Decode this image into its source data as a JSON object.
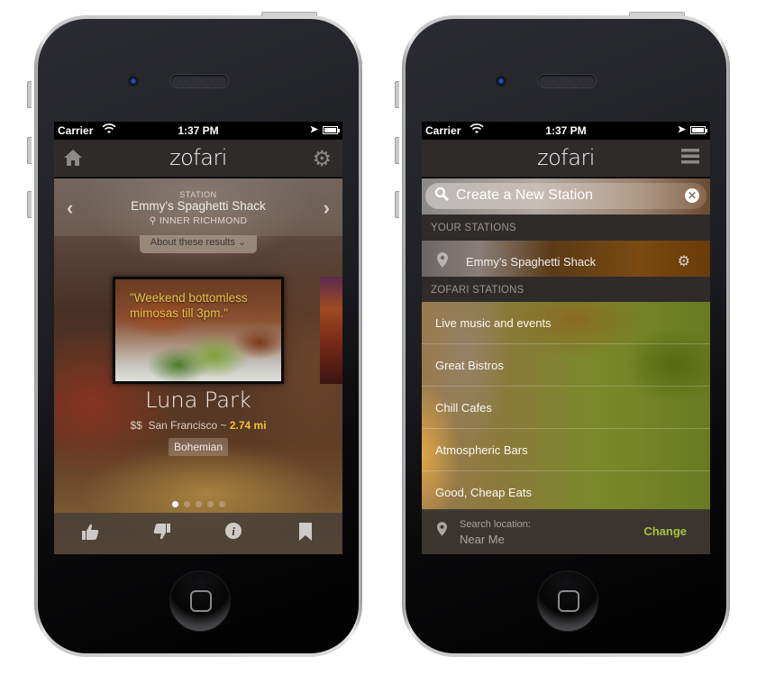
{
  "status_bar": {
    "carrier": "Carrier",
    "time": "1:37 PM",
    "wifi_icon": "wifi-icon",
    "location_icon": "location-arrow-icon",
    "battery_icon": "battery-icon"
  },
  "app": {
    "logo": "zofari"
  },
  "left_screen": {
    "nav": {
      "home_icon": "⌂",
      "settings_icon": "⚙"
    },
    "station": {
      "label": "STATION",
      "name": "Emmy's Spaghetti Shack",
      "area": "INNER RICHMOND",
      "prev_icon": "‹",
      "next_icon": "›"
    },
    "about_results": "About these results ❤",
    "card": {
      "quote": "\"Weekend bottomless mimosas till 3pm.\"",
      "venue_name": "Luna Park",
      "price": "$$",
      "city": "San Francisco ~",
      "distance": "2.74 mi",
      "tag": "Bohemian"
    },
    "pager": {
      "total": 5,
      "active": 1
    },
    "actions": [
      {
        "name": "like",
        "icon": "👍"
      },
      {
        "name": "dislike",
        "icon": "👎"
      },
      {
        "name": "info",
        "icon": "ℹ"
      },
      {
        "name": "bookmark",
        "icon": "🔖"
      }
    ]
  },
  "right_screen": {
    "nav": {
      "menu_icon": "☰"
    },
    "search": {
      "placeholder": "Create a New Station",
      "search_icon": "🔍",
      "clear_icon": "✕"
    },
    "your_stations": {
      "header": "YOUR STATIONS",
      "items": [
        {
          "label": "Emmy's Spaghetti Shack",
          "pin_icon": "📍",
          "gear_icon": "⚙"
        }
      ]
    },
    "zofari_stations": {
      "header": "ZOFARI STATIONS",
      "items": [
        {
          "label": "Live music and events"
        },
        {
          "label": "Great Bistros"
        },
        {
          "label": "Chill Cafes"
        },
        {
          "label": "Atmospheric Bars"
        },
        {
          "label": "Good, Cheap Eats"
        }
      ]
    },
    "location": {
      "label": "Search location:",
      "value": "Near Me",
      "change": "Change"
    }
  },
  "colors": {
    "accent_yellow": "#f1c232",
    "accent_green": "#a9c43b",
    "nav_bg": "#2f2b2b"
  }
}
